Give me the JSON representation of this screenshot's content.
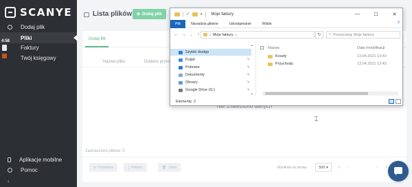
{
  "app": {
    "logo_text": "SCANYE",
    "clock": "4:58"
  },
  "sidebar": {
    "items": [
      {
        "label": "Dodaj plik",
        "icon": "gear-icon"
      },
      {
        "label": "Pliki",
        "icon": "files-icon"
      },
      {
        "label": "Faktury",
        "icon": "invoice-icon"
      },
      {
        "label": "Twój księgowy",
        "icon": "accountant-icon"
      }
    ],
    "bottom_items": [
      {
        "label": "Aplikacje mobilne",
        "icon": "phone-icon"
      },
      {
        "label": "Pomoc",
        "icon": "help-icon"
      }
    ]
  },
  "header": {
    "title": "Lista plików",
    "add_button": "Dodaj plik"
  },
  "filters": {
    "add_filter": "Dodaj filtr"
  },
  "table": {
    "columns": [
      "Nazwa pliku",
      "Dodano przez"
    ],
    "empty_message": "Nie znaleziono danych"
  },
  "footer": {
    "selected_label": "Zaznaczono plików: 0",
    "actions": [
      "Przetwórz",
      "Pobierz",
      "Usuń"
    ],
    "per_page_label": "Wyników na stronę:",
    "per_page_value": "500",
    "pager": [
      "«",
      "‹",
      "›",
      "»"
    ]
  },
  "explorer": {
    "title": "Moje faktury",
    "window_controls": [
      "—",
      "☐",
      "✕"
    ],
    "ribbon_tabs": [
      "Plik",
      "Narzędzia główne",
      "Udostępnianie",
      "Widok"
    ],
    "ribbon_help": "?",
    "nav_arrows": [
      "←",
      "→",
      "⌄",
      "↑"
    ],
    "address": "Moje faktury",
    "address_chevron": "›",
    "search_placeholder": "Przeszukaj: Moje faktury",
    "nav_pane": [
      {
        "label": "Szybki dostęp",
        "icon": "star-icon",
        "pinned": false
      },
      {
        "label": "Pulpit",
        "icon": "desktop-icon",
        "pinned": true
      },
      {
        "label": "Pobrane",
        "icon": "download-icon",
        "pinned": true
      },
      {
        "label": "Dokumenty",
        "icon": "documents-icon",
        "pinned": true
      },
      {
        "label": "Obrazy",
        "icon": "pictures-icon",
        "pinned": true
      },
      {
        "label": "Google Drive (G:)",
        "icon": "drive-icon",
        "pinned": true
      }
    ],
    "columns": {
      "name": "Nazwa",
      "date": "Data modyfikacji"
    },
    "files": [
      {
        "name": "Koszty",
        "date": "13.04.2021 13:43"
      },
      {
        "name": "Przychody",
        "date": "13.04.2021 13:43"
      }
    ],
    "status": "Elementy: 2",
    "colors": {
      "accent": "#1b66b8",
      "folder": "#e8c35a"
    }
  },
  "colors": {
    "sidebar_bg": "#2c2f33",
    "brand_green": "#5ab889",
    "chat_bubble": "#2e5a8e"
  }
}
